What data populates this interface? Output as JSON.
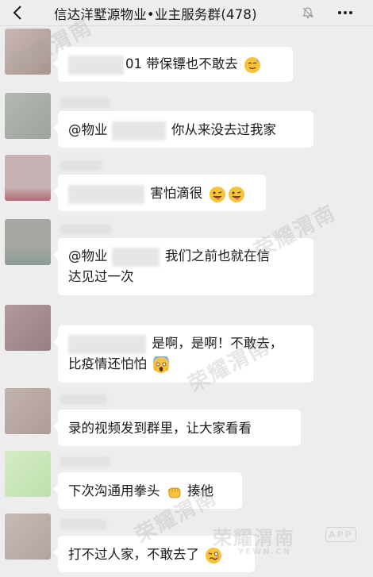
{
  "header": {
    "title": "信达洋墅源物业•业主服务群(478)"
  },
  "messages": [
    {
      "suffix": "01",
      "text": "带保镖也不敢去",
      "emoji": "sweat-smile-icon"
    },
    {
      "prefix": "@物业",
      "text": "你从来没去过我家"
    },
    {
      "text": "害怕滴很",
      "emojis": [
        "wink-tongue-icon",
        "wink-tongue-icon"
      ]
    },
    {
      "prefix": "@物业",
      "line1": "我们之前也就在信",
      "line2": "达见过一次"
    },
    {
      "line1": "是啊，是啊！不敢去，",
      "line2": "比疫情还怕怕",
      "emoji": "screaming-face-icon"
    },
    {
      "text": "录的视频发到群里，让大家看看"
    },
    {
      "text_a": "下次沟通用拳头",
      "text_b": "揍他",
      "emoji": "fist-icon"
    },
    {
      "text": "打不过人家，不敢去了",
      "emoji": "woozy-face-icon"
    }
  ],
  "watermark": {
    "brand": "荣耀渭南",
    "domain": "YEWN.CN",
    "badge": "APP"
  },
  "colors": {
    "background": "#ededed",
    "bubble": "#ffffff",
    "text": "#1a1a1a"
  }
}
